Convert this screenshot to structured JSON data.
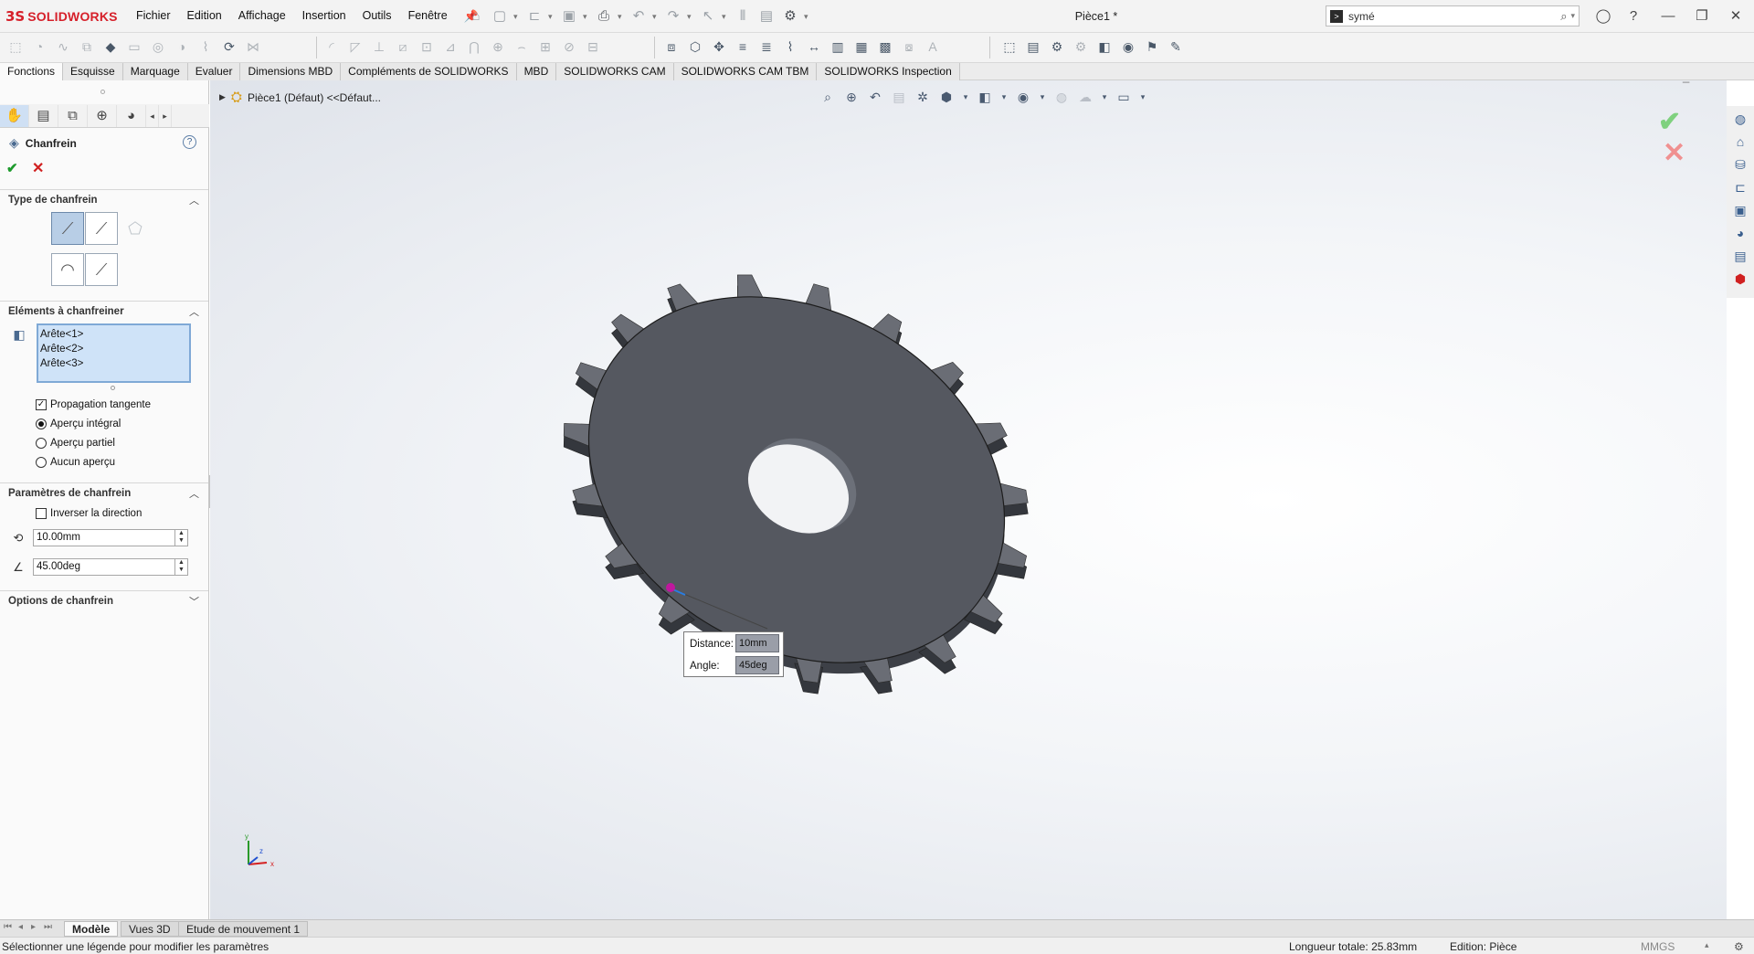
{
  "app": {
    "logo_ds": "3S",
    "logo_text": "SOLIDWORKS",
    "menu": [
      "Fichier",
      "Edition",
      "Affichage",
      "Insertion",
      "Outils",
      "Fenêtre"
    ],
    "pin_icon": "pin-icon",
    "doc_title": "Pièce1 *",
    "search_text": "symé"
  },
  "tabs": [
    "Fonctions",
    "Esquisse",
    "Marquage",
    "Evaluer",
    "Dimensions MBD",
    "Compléments de SOLIDWORKS",
    "MBD",
    "SOLIDWORKS CAM",
    "SOLIDWORKS CAM TBM",
    "SOLIDWORKS Inspection"
  ],
  "property_manager": {
    "title": "Chanfrein",
    "sections": {
      "type": "Type de chanfrein",
      "elements": "Eléments à chanfreiner",
      "params": "Paramètres de chanfrein",
      "options": "Options de chanfrein"
    },
    "edges": [
      "Arête<1>",
      "Arête<2>",
      "Arête<3>"
    ],
    "tangent_propagation": "Propagation tangente",
    "preview_options": [
      "Aperçu intégral",
      "Aperçu partiel",
      "Aucun aperçu"
    ],
    "selected_preview": "Aperçu intégral",
    "reverse_direction": "Inverser la direction",
    "distance": "10.00mm",
    "angle": "45.00deg"
  },
  "graphics": {
    "tree_label": "Pièce1 (Défaut) <<Défaut...",
    "callout": {
      "distance_label": "Distance:",
      "distance_value": "10mm",
      "angle_label": "Angle:",
      "angle_value": "45deg"
    },
    "triad_x": "x",
    "triad_y": "y",
    "triad_z": "z",
    "gear_color": "#555860"
  },
  "bottom_tabs": [
    "Modèle",
    "Vues 3D",
    "Etude de mouvement 1"
  ],
  "status": {
    "message": "Sélectionner une légende pour modifier les paramètres",
    "total_length": "Longueur totale: 25.83mm",
    "edition": "Edition: Pièce",
    "units": "MMGS"
  }
}
